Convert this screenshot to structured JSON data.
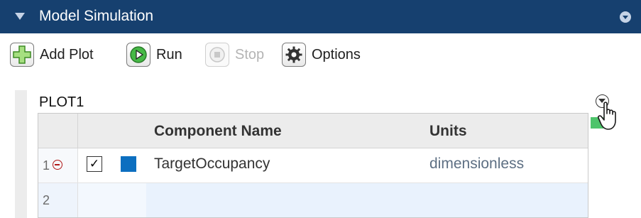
{
  "panel": {
    "title": "Model Simulation"
  },
  "toolbar": {
    "add_plot_label": "Add Plot",
    "run_label": "Run",
    "stop_label": "Stop",
    "options_label": "Options"
  },
  "plot": {
    "title": "PLOT1",
    "columns": {
      "component_name": "Component Name",
      "units": "Units"
    },
    "rows": [
      {
        "number": "1",
        "checked": true,
        "check_glyph": "✓",
        "color": "#0c6fc0",
        "component": "TargetOccupancy",
        "units": "dimensionless"
      },
      {
        "number": "2",
        "component": "",
        "units": ""
      }
    ]
  },
  "colors": {
    "header_bg": "#16406f",
    "accent_green": "#4ec46b",
    "series_blue": "#0c6fc0"
  },
  "icons": [
    "collapse-triangle-icon",
    "panel-menu-icon",
    "add-plot-icon",
    "run-icon",
    "stop-icon",
    "gear-icon",
    "remove-row-icon",
    "options-dropdown-icon",
    "hand-cursor-icon"
  ]
}
